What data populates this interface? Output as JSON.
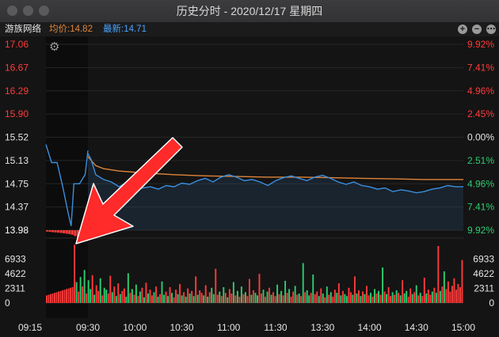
{
  "window": {
    "title": "历史分时 - 2020/12/17 星期四"
  },
  "info": {
    "stock_name": "游族网络",
    "avg_label": "均价:14.82",
    "latest_label": "最新:14.71"
  },
  "colors": {
    "up": "#ff3b3b",
    "down": "#2ecc71",
    "flat": "#e6e6e6",
    "price_line": "#3a8fe0",
    "avg_line": "#e0843a",
    "avg_text": "#e0843a",
    "latest_text": "#4aa3ff",
    "background": "#141414",
    "annotation_arrow": "#ff2a2a"
  },
  "chart_data": {
    "type": "line",
    "price_axis": {
      "left_labels": [
        "17.06",
        "16.67",
        "16.29",
        "15.90",
        "15.52",
        "15.13",
        "14.75",
        "14.37",
        "13.98"
      ],
      "right_labels": [
        "9.92%",
        "7.41%",
        "4.96%",
        "2.45%",
        "0.00%",
        "2.51%",
        "4.96%",
        "7.41%",
        "9.92%"
      ],
      "ylim": [
        13.98,
        17.06
      ],
      "prev_close": 15.52
    },
    "volume_axis": {
      "labels": [
        "6933",
        "4622",
        "2311",
        "0"
      ],
      "ylim": [
        0,
        9244
      ]
    },
    "x_labels": [
      "09:15",
      "09:30",
      "10:00",
      "10:30",
      "11:00",
      "11:30",
      "13:30",
      "14:00",
      "14:30",
      "15:00"
    ],
    "pre_market": {
      "time": [
        0,
        2,
        4,
        6,
        8,
        9,
        10,
        11,
        12,
        14,
        15
      ],
      "price": [
        15.4,
        15.1,
        15.1,
        14.7,
        14.25,
        14.05,
        14.75,
        14.75,
        14.75,
        14.9,
        15.3
      ]
    },
    "series": [
      {
        "name": "最新",
        "time": [
          15,
          17,
          20,
          25,
          30,
          35,
          40,
          45,
          50,
          55,
          60,
          65,
          70,
          75,
          80,
          85,
          90,
          95,
          100,
          105,
          110,
          115,
          120,
          125,
          130,
          135,
          140,
          145,
          150,
          155,
          160,
          165,
          170,
          175,
          180,
          185,
          190,
          195,
          200,
          205,
          210,
          215,
          220,
          225,
          230,
          235,
          240,
          245,
          250,
          255
        ],
        "values": [
          15.25,
          15.15,
          14.9,
          14.82,
          14.78,
          14.7,
          14.78,
          14.65,
          14.68,
          14.7,
          14.66,
          14.72,
          14.7,
          14.76,
          14.74,
          14.8,
          14.84,
          14.78,
          14.86,
          14.9,
          14.86,
          14.8,
          14.82,
          14.78,
          14.72,
          14.8,
          14.85,
          14.88,
          14.84,
          14.8,
          14.86,
          14.89,
          14.84,
          14.78,
          14.74,
          14.78,
          14.72,
          14.7,
          14.66,
          14.68,
          14.62,
          14.65,
          14.63,
          14.6,
          14.62,
          14.66,
          14.68,
          14.72,
          14.7,
          14.7
        ]
      },
      {
        "name": "均价",
        "time": [
          15,
          20,
          25,
          35,
          50,
          70,
          90,
          110,
          130,
          150,
          170,
          190,
          210,
          230,
          255
        ],
        "values": [
          15.2,
          15.05,
          15.0,
          14.96,
          14.93,
          14.9,
          14.88,
          14.87,
          14.86,
          14.86,
          14.85,
          14.84,
          14.83,
          14.82,
          14.82
        ]
      }
    ],
    "pre_market_imbalance": [
      200,
      260,
      300,
      340,
      380,
      420,
      480,
      540,
      600,
      700,
      900,
      1100,
      1300,
      1500,
      1700
    ],
    "volume": {
      "values": [
        1200,
        1300,
        1400,
        1500,
        1600,
        1700,
        1800,
        1900,
        2000,
        2100,
        2200,
        2300,
        2400,
        2500,
        9200,
        3300,
        1800,
        4100,
        2600,
        5200,
        1500,
        3600,
        2200,
        4400,
        1300,
        2800,
        1900,
        3900,
        1200,
        2400,
        2100,
        1500,
        4300,
        1700,
        2600,
        1100,
        3100,
        1400,
        1900,
        2300,
        1000,
        4700,
        1600,
        2200,
        1300,
        2900,
        1100,
        1800,
        2400,
        900,
        3200,
        1500,
        2100,
        1200,
        1700,
        2600,
        1000,
        1400,
        3400,
        1300,
        1800,
        1100,
        2500,
        1600,
        900,
        2100,
        1400,
        3000,
        1200,
        1700,
        1000,
        2300,
        1500,
        1900,
        1100,
        4200,
        1300,
        2000,
        1600,
        1200,
        2800,
        1000,
        1700,
        2400,
        1400,
        5400,
        1300,
        1800,
        1100,
        2500,
        1600,
        900,
        2200,
        1500,
        3300,
        1200,
        1900,
        1000,
        2600,
        1400,
        1700,
        1100,
        3800,
        1300,
        2000,
        1600,
        1200,
        4600,
        1500,
        2100,
        1000,
        1800,
        2400,
        1300,
        1700,
        1100,
        2900,
        1400,
        1900,
        1200,
        3500,
        1600,
        2200,
        1000,
        1800,
        2700,
        1300,
        1500,
        1100,
        6300,
        1700,
        2000,
        1200,
        1600,
        4500,
        1400,
        1800,
        1100,
        2300,
        1500,
        900,
        2600,
        1300,
        1700,
        1000,
        2100,
        1600,
        3100,
        1200,
        1900,
        1400,
        1100,
        2400,
        1700,
        1300,
        4200,
        1500,
        2000,
        1100,
        1800,
        1400,
        2700,
        1200,
        1600,
        1000,
        2200,
        1500,
        1900,
        1300,
        5600,
        1800,
        1400,
        2500,
        1100,
        1700,
        1300,
        2000,
        1600,
        1200,
        3600,
        1500,
        1900,
        1000,
        2300,
        1400,
        1700,
        2800,
        1200,
        1600,
        1100,
        4000,
        1500,
        2100,
        1300,
        1800,
        2400,
        1600,
        9000,
        1900,
        2600,
        5000,
        2200,
        3400,
        1800,
        2700,
        3900,
        2100,
        3000,
        2500,
        6800
      ],
      "colors": "red,red,red,red,red,red,red,red,red,red,red,red,red,red,red,green,red,green,red,green,red,green,green,red,green,red,red,green,red,green,green,red,red,green,red,green,red,green,red,red,green,green,red,green,red,green,red,green,red,green,red,green,red,red,green,red,green,red,green,green,red,green,red,green,red,red,green,red,green,red,green,red,green,red,green,red,green,red,red,green,red,green,red,green,green,red,red,green,red,green,red,green,red,red,green,red,green,red,green,red,green,red,red,green,red,green,green,red,red,green,red,green,red,green,red,red,green,red,green,red,green,red,green,red,red,green,red,green,red,green,red,green,green,red,green,red,red,green,red,green,red,green,red,green,red,red,green,red,green,red,green,green,red,red,green,red,green,red,green,red,green,red,red,green,red,green,red,green,red,green,red,green,red,red,green,red,green,red,green,red,green,green,red,red,green,red,green,red,green,red,red,green,red,red,green,red,green,red,green,red,green,red"
    }
  }
}
